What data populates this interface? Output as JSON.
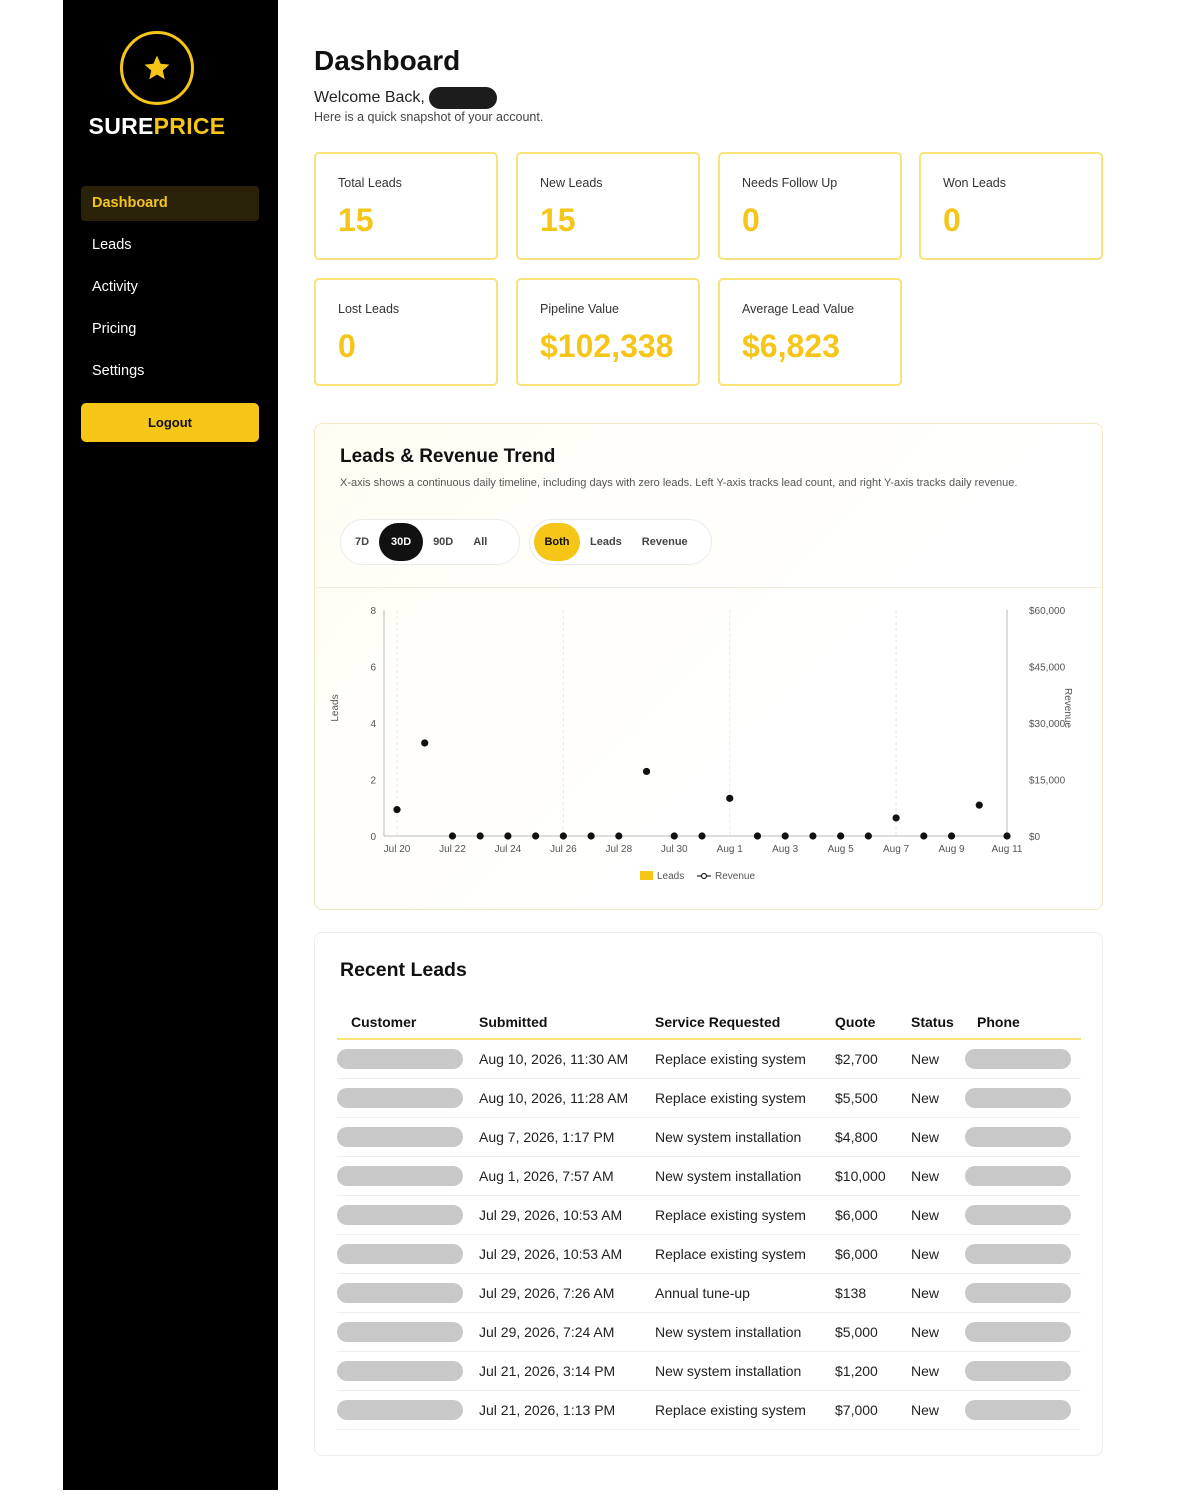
{
  "brand": {
    "name_part1": "SURE",
    "name_part2": "PRICE",
    "accent_color": "#f5c518"
  },
  "sidebar": {
    "items": [
      {
        "label": "Dashboard",
        "active": true
      },
      {
        "label": "Leads"
      },
      {
        "label": "Activity"
      },
      {
        "label": "Pricing"
      },
      {
        "label": "Settings"
      }
    ],
    "logout_label": "Logout"
  },
  "header": {
    "title": "Dashboard",
    "welcome": "Welcome Back,",
    "subtitle": "Here is a quick snapshot of your account."
  },
  "stats": [
    {
      "label": "Total Leads",
      "value": "15"
    },
    {
      "label": "New Leads",
      "value": "15"
    },
    {
      "label": "Needs Follow Up",
      "value": "0"
    },
    {
      "label": "Won Leads",
      "value": "0"
    },
    {
      "label": "Lost Leads",
      "value": "0"
    },
    {
      "label": "Pipeline Value",
      "value": "$102,338"
    },
    {
      "label": "Average Lead Value",
      "value": "$6,823"
    }
  ],
  "trend": {
    "title": "Leads & Revenue Trend",
    "description": "X-axis shows a continuous daily timeline, including days with zero leads. Left Y-axis tracks lead count, and right Y-axis tracks daily revenue.",
    "range_options": [
      "7D",
      "30D",
      "90D",
      "All"
    ],
    "range_selected": "30D",
    "mode_options": [
      "Both",
      "Leads",
      "Revenue"
    ],
    "mode_selected": "Both"
  },
  "chart_data": {
    "type": "scatter",
    "x": [
      "Jul 20",
      "Jul 21",
      "Jul 22",
      "Jul 23",
      "Jul 24",
      "Jul 25",
      "Jul 26",
      "Jul 27",
      "Jul 28",
      "Jul 29",
      "Jul 30",
      "Jul 31",
      "Aug 1",
      "Aug 2",
      "Aug 3",
      "Aug 4",
      "Aug 5",
      "Aug 6",
      "Aug 7",
      "Aug 8",
      "Aug 9",
      "Aug 10",
      "Aug 11"
    ],
    "x_tick_labels": [
      "Jul 20",
      "Jul 22",
      "Jul 24",
      "Jul 26",
      "Jul 28",
      "Jul 30",
      "Aug 1",
      "Aug 3",
      "Aug 5",
      "Aug 7",
      "Aug 9",
      "Aug 11"
    ],
    "series": [
      {
        "name": "Leads",
        "axis": "left",
        "values": [
          0,
          0,
          0,
          0,
          0,
          0,
          0,
          0,
          0,
          0,
          0,
          0,
          0,
          0,
          0,
          0,
          0,
          0,
          0,
          0,
          0,
          0,
          0
        ]
      },
      {
        "name": "Revenue",
        "axis": "right",
        "values": [
          7000,
          24700,
          0,
          0,
          0,
          0,
          0,
          0,
          0,
          17138,
          0,
          0,
          10000,
          0,
          0,
          0,
          0,
          0,
          4800,
          0,
          0,
          8200,
          0
        ]
      }
    ],
    "ylabel": "Leads",
    "y2label": "Revenue",
    "ylim": [
      0,
      8
    ],
    "y_ticks": [
      "0",
      "2",
      "4",
      "6",
      "8"
    ],
    "y2lim": [
      0,
      60000
    ],
    "y2_ticks": [
      "$0",
      "$15,000",
      "$30,000",
      "$45,000",
      "$60,000"
    ],
    "grid": true,
    "legend_position": "bottom"
  },
  "recent": {
    "title": "Recent Leads",
    "columns": [
      "Customer",
      "Submitted",
      "Service Requested",
      "Quote",
      "Status",
      "Phone"
    ],
    "rows": [
      {
        "submitted": "Aug 10, 2026, 11:30 AM",
        "service": "Replace existing system",
        "quote": "$2,700",
        "status": "New"
      },
      {
        "submitted": "Aug 10, 2026, 11:28 AM",
        "service": "Replace existing system",
        "quote": "$5,500",
        "status": "New"
      },
      {
        "submitted": "Aug 7, 2026, 1:17 PM",
        "service": "New system installation",
        "quote": "$4,800",
        "status": "New"
      },
      {
        "submitted": "Aug 1, 2026, 7:57 AM",
        "service": "New system installation",
        "quote": "$10,000",
        "status": "New"
      },
      {
        "submitted": "Jul 29, 2026, 10:53 AM",
        "service": "Replace existing system",
        "quote": "$6,000",
        "status": "New"
      },
      {
        "submitted": "Jul 29, 2026, 10:53 AM",
        "service": "Replace existing system",
        "quote": "$6,000",
        "status": "New"
      },
      {
        "submitted": "Jul 29, 2026, 7:26 AM",
        "service": "Annual tune-up",
        "quote": "$138",
        "status": "New"
      },
      {
        "submitted": "Jul 29, 2026, 7:24 AM",
        "service": "New system installation",
        "quote": "$5,000",
        "status": "New"
      },
      {
        "submitted": "Jul 21, 2026, 3:14 PM",
        "service": "New system installation",
        "quote": "$1,200",
        "status": "New"
      },
      {
        "submitted": "Jul 21, 2026, 1:13 PM",
        "service": "Replace existing system",
        "quote": "$7,000",
        "status": "New"
      }
    ]
  }
}
